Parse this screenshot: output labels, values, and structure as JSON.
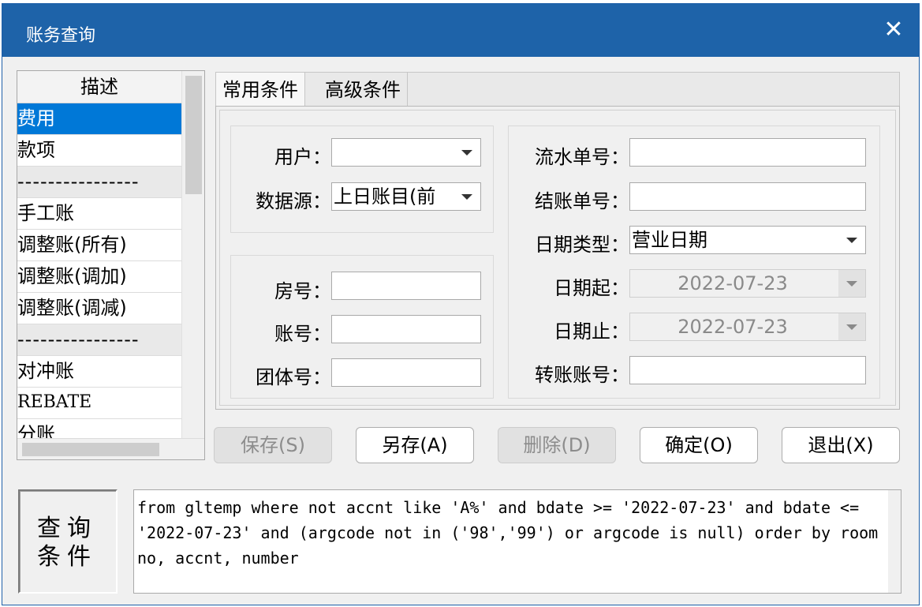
{
  "window": {
    "title": "账务查询"
  },
  "list": {
    "header": "描述",
    "items": [
      {
        "label": "费用"
      },
      {
        "label": "款项"
      },
      {
        "label": "----------------"
      },
      {
        "label": "手工账"
      },
      {
        "label": "调整账(所有)"
      },
      {
        "label": "调整账(调加)"
      },
      {
        "label": "调整账(调减)"
      },
      {
        "label": "----------------"
      },
      {
        "label": "对冲账"
      },
      {
        "label": "REBATE"
      },
      {
        "label": "分账"
      }
    ]
  },
  "tabs": [
    {
      "label": "常用条件"
    },
    {
      "label": "高级条件"
    }
  ],
  "form": {
    "user_label": "用户：",
    "user_value": "",
    "datasource_label": "数据源：",
    "datasource_value": "上日账目(前",
    "room_label": "房号：",
    "room_value": "",
    "account_label": "账号：",
    "account_value": "",
    "group_label": "团体号：",
    "group_value": "",
    "serial_label": "流水单号：",
    "serial_value": "",
    "checkout_label": "结账单号：",
    "checkout_value": "",
    "datetype_label": "日期类型：",
    "datetype_value": "营业日期",
    "date_from_label": "日期起：",
    "date_from_value": "2022-07-23",
    "date_to_label": "日期止：",
    "date_to_value": "2022-07-23",
    "transfer_label": "转账账号：",
    "transfer_value": ""
  },
  "buttons": {
    "save": "保存(S)",
    "save_as": "另存(A)",
    "delete": "删除(D)",
    "ok": "确定(O)",
    "exit": "退出(X)"
  },
  "query": {
    "label": "查询\n条件",
    "sql": "from gltemp where not accnt like 'A%' and bdate >= '2022-07-23' and bdate <= '2022-07-23' and (argcode not in ('98','99') or argcode is null) order by roomno, accnt, number"
  }
}
